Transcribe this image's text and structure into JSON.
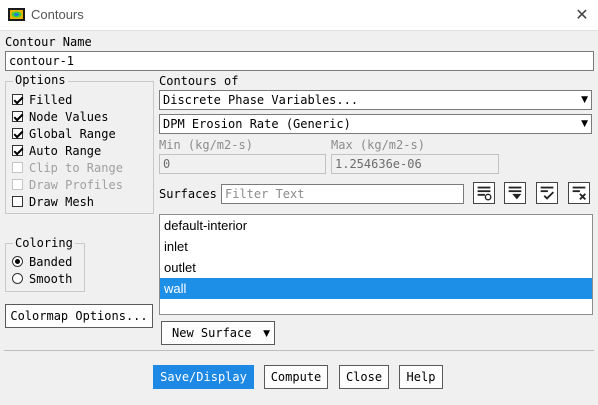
{
  "window": {
    "title": "Contours",
    "close_glyph": "✕",
    "icon": "contour-app-icon"
  },
  "contour_name": {
    "label": "Contour Name",
    "value": "contour-1"
  },
  "options": {
    "title": "Options",
    "items": [
      {
        "label": "Filled",
        "checked": true,
        "enabled": true
      },
      {
        "label": "Node Values",
        "checked": true,
        "enabled": true
      },
      {
        "label": "Global Range",
        "checked": true,
        "enabled": true
      },
      {
        "label": "Auto Range",
        "checked": true,
        "enabled": true
      },
      {
        "label": "Clip to Range",
        "checked": false,
        "enabled": false
      },
      {
        "label": "Draw Profiles",
        "checked": false,
        "enabled": false
      },
      {
        "label": "Draw Mesh",
        "checked": false,
        "enabled": true
      }
    ]
  },
  "coloring": {
    "title": "Coloring",
    "options": [
      {
        "label": "Banded",
        "selected": true
      },
      {
        "label": "Smooth",
        "selected": false
      }
    ]
  },
  "colormap_button": "Colormap Options...",
  "contours_of": {
    "label": "Contours of",
    "category": "Discrete Phase Variables...",
    "variable": "DPM Erosion Rate (Generic)"
  },
  "range": {
    "min_label": "Min (kg/m2-s)",
    "min_value": "0",
    "max_label": "Max (kg/m2-s)",
    "max_value": "1.254636e-06"
  },
  "surfaces": {
    "label": "Surfaces",
    "filter_placeholder": "Filter Text",
    "items": [
      "default-interior",
      "inlet",
      "outlet",
      "wall"
    ],
    "selected": "wall",
    "tool_icons": [
      "select-all-icon",
      "deselect-all-icon",
      "check-all-icon",
      "clear-all-icon"
    ]
  },
  "new_surface_button": "New Surface",
  "footer": {
    "save_display": "Save/Display",
    "compute": "Compute",
    "close": "Close",
    "help": "Help"
  },
  "colors": {
    "accent": "#1e88e5",
    "selection": "#1e8fe7"
  }
}
